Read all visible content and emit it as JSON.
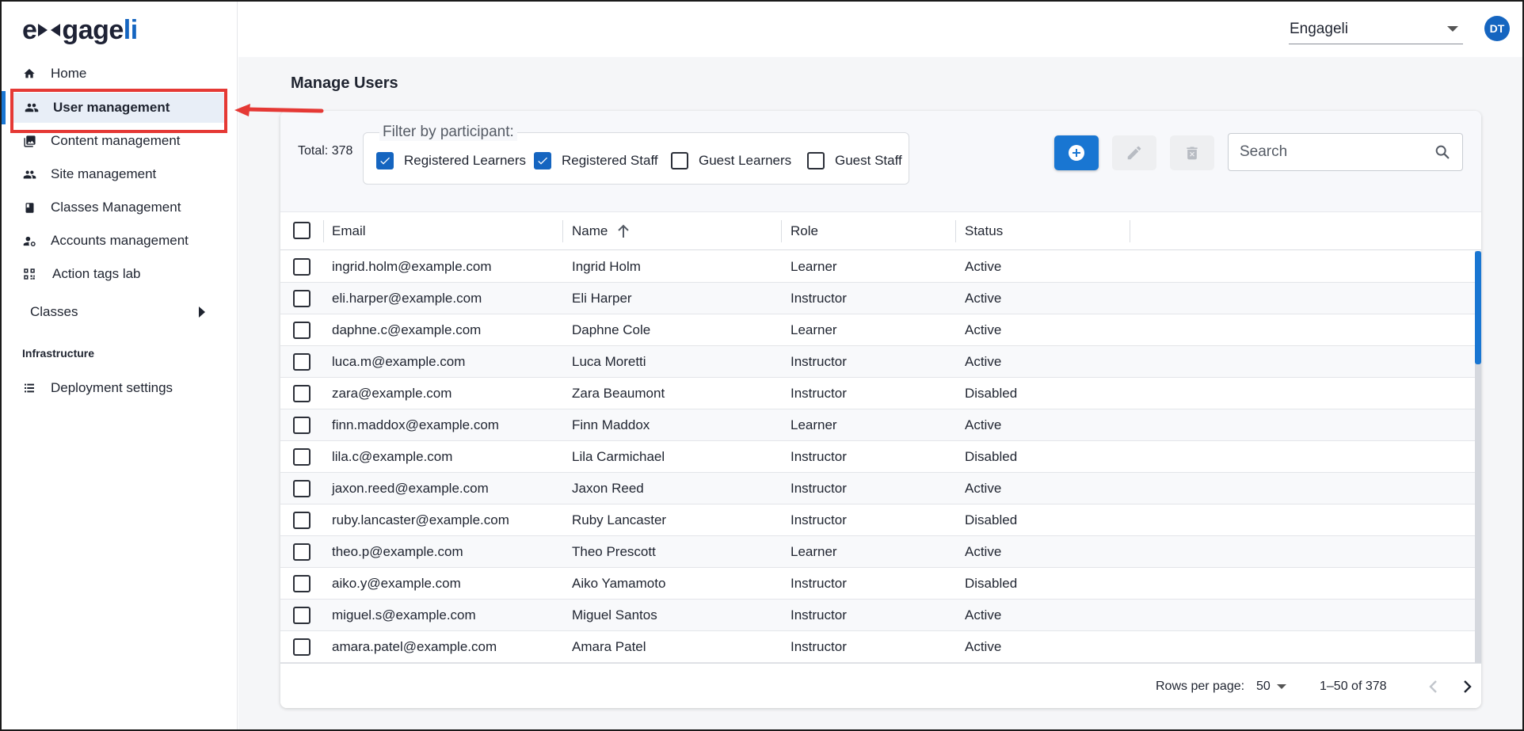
{
  "app": {
    "logo_left": "e",
    "logo_mid": "gage",
    "logo_accent": "li",
    "tenant": "Engageli",
    "avatar_initials": "DT"
  },
  "sidebar": {
    "items": [
      {
        "label": "Home",
        "icon": "home-icon"
      },
      {
        "label": "User management",
        "icon": "users-icon",
        "active": true
      },
      {
        "label": "Content management",
        "icon": "photo-library-icon"
      },
      {
        "label": "Site management",
        "icon": "people-icon"
      },
      {
        "label": "Classes Management",
        "icon": "book-icon"
      },
      {
        "label": "Accounts management",
        "icon": "manage-accounts-icon"
      },
      {
        "label": "Action tags lab",
        "icon": "qr-code-icon"
      }
    ],
    "classes_label": "Classes",
    "section_title": "Infrastructure",
    "deployment_label": "Deployment settings"
  },
  "main": {
    "title": "Manage Users",
    "total_label": "Total: 378",
    "filter_legend": "Filter by participant:",
    "filters": [
      {
        "label": "Registered Learners",
        "checked": true
      },
      {
        "label": "Registered Staff",
        "checked": true
      },
      {
        "label": "Guest Learners",
        "checked": false
      },
      {
        "label": "Guest Staff",
        "checked": false
      }
    ],
    "search_placeholder": "Search"
  },
  "table": {
    "columns": [
      "Email",
      "Name",
      "Role",
      "Status"
    ],
    "rows": [
      {
        "email": "ingrid.holm@example.com",
        "name": "Ingrid Holm",
        "role": "Learner",
        "status": "Active"
      },
      {
        "email": "eli.harper@example.com",
        "name": "Eli Harper",
        "role": "Instructor",
        "status": "Active"
      },
      {
        "email": "daphne.c@example.com",
        "name": "Daphne Cole",
        "role": "Learner",
        "status": "Active"
      },
      {
        "email": "luca.m@example.com",
        "name": "Luca Moretti",
        "role": "Instructor",
        "status": "Active"
      },
      {
        "email": "zara@example.com",
        "name": "Zara Beaumont",
        "role": "Instructor",
        "status": "Disabled"
      },
      {
        "email": "finn.maddox@example.com",
        "name": "Finn Maddox",
        "role": "Learner",
        "status": "Active"
      },
      {
        "email": "lila.c@example.com",
        "name": "Lila Carmichael",
        "role": "Instructor",
        "status": "Disabled"
      },
      {
        "email": "jaxon.reed@example.com",
        "name": "Jaxon Reed",
        "role": "Instructor",
        "status": "Active"
      },
      {
        "email": "ruby.lancaster@example.com",
        "name": "Ruby Lancaster",
        "role": "Instructor",
        "status": "Disabled"
      },
      {
        "email": "theo.p@example.com",
        "name": "Theo Prescott",
        "role": "Learner",
        "status": "Active"
      },
      {
        "email": "aiko.y@example.com",
        "name": "Aiko Yamamoto",
        "role": "Instructor",
        "status": "Disabled"
      },
      {
        "email": "miguel.s@example.com",
        "name": "Miguel Santos",
        "role": "Instructor",
        "status": "Active"
      },
      {
        "email": "amara.patel@example.com",
        "name": "Amara Patel",
        "role": "Instructor",
        "status": "Active"
      }
    ]
  },
  "pagination": {
    "rows_per_page_label": "Rows per page:",
    "rows_per_page": "50",
    "range": "1–50 of 378"
  },
  "colors": {
    "accent": "#1976d2",
    "highlight": "#e53935"
  }
}
